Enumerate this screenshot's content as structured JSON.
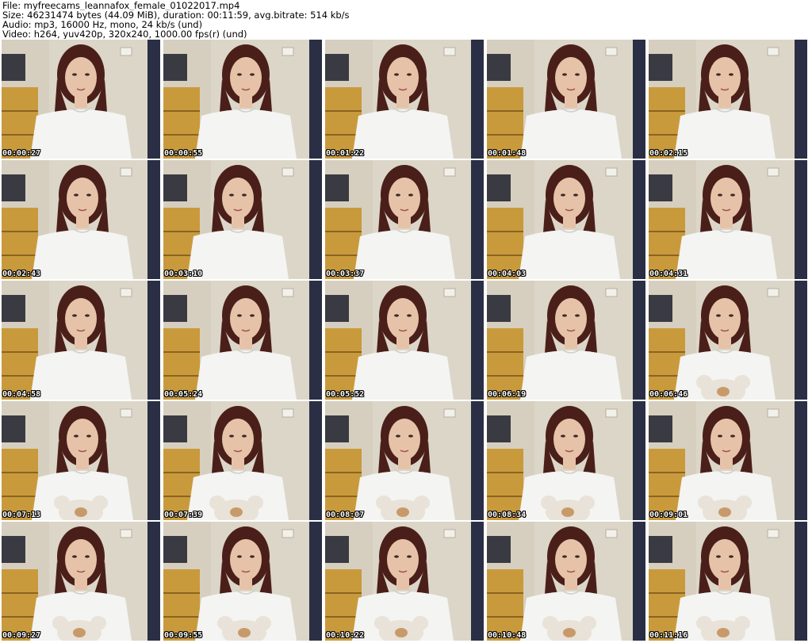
{
  "header": {
    "file": "File: myfreecams_leannafox_female_01022017.mp4",
    "size": "Size: 46231474 bytes (44.09 MiB), duration: 00:11:59, avg.bitrate: 514 kb/s",
    "audio": "Audio: mp3, 16000 Hz, mono, 24 kb/s (und)",
    "video": "Video: h264, yuv420p, 320x240, 1000.00 fps(r) (und)"
  },
  "colors": {
    "background": "#ffffff",
    "wall": "#dcd6c8",
    "dresser": "#c99a3c",
    "door": "#2a2f45",
    "shirt": "#f4f4f2",
    "hair": "#4a1f1a",
    "skin": "#e6c3a8",
    "plush": "#e8e2d8"
  },
  "thumbnails": [
    {
      "time": "00:00:27"
    },
    {
      "time": "00:00:55"
    },
    {
      "time": "00:01:22"
    },
    {
      "time": "00:01:48"
    },
    {
      "time": "00:02:15"
    },
    {
      "time": "00:02:43"
    },
    {
      "time": "00:03:10"
    },
    {
      "time": "00:03:37"
    },
    {
      "time": "00:04:03"
    },
    {
      "time": "00:04:31"
    },
    {
      "time": "00:04:58"
    },
    {
      "time": "00:05:24"
    },
    {
      "time": "00:05:52"
    },
    {
      "time": "00:06:19"
    },
    {
      "time": "00:06:46"
    },
    {
      "time": "00:07:13"
    },
    {
      "time": "00:07:39"
    },
    {
      "time": "00:08:07"
    },
    {
      "time": "00:08:34"
    },
    {
      "time": "00:09:01"
    },
    {
      "time": "00:09:27"
    },
    {
      "time": "00:09:55"
    },
    {
      "time": "00:10:22"
    },
    {
      "time": "00:10:48"
    },
    {
      "time": "00:11:16"
    }
  ]
}
